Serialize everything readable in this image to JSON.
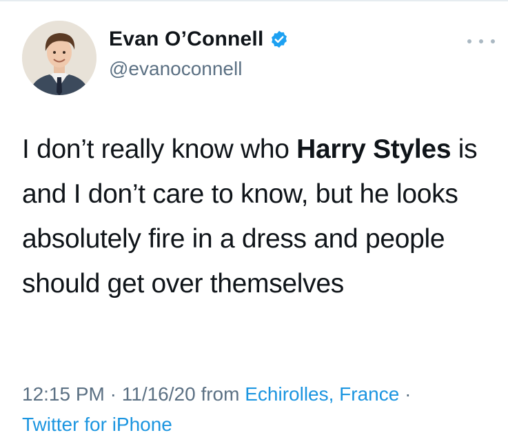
{
  "author": {
    "display_name": "Evan O’Connell",
    "handle": "@evanoconnell",
    "verified": true,
    "avatar_icon": "profile-photo"
  },
  "tweet": {
    "text_part1": "I don’t really know who ",
    "text_bold": "Harry Styles",
    "text_part2": " is and I don’t care to know, but he looks absolutely fire in a dress and people should get over themselves"
  },
  "meta": {
    "time": "12:15 PM",
    "separator": " · ",
    "date": "11/16/20",
    "from_label": " from ",
    "location": "Echirolles, France",
    "separator2": " ·",
    "source": "Twitter for iPhone"
  },
  "colors": {
    "link": "#1b95e0",
    "secondary": "#5b7083",
    "verified": "#1da1f2"
  },
  "icons": {
    "verified": "verified-badge-icon",
    "more": "more-dots-icon"
  }
}
